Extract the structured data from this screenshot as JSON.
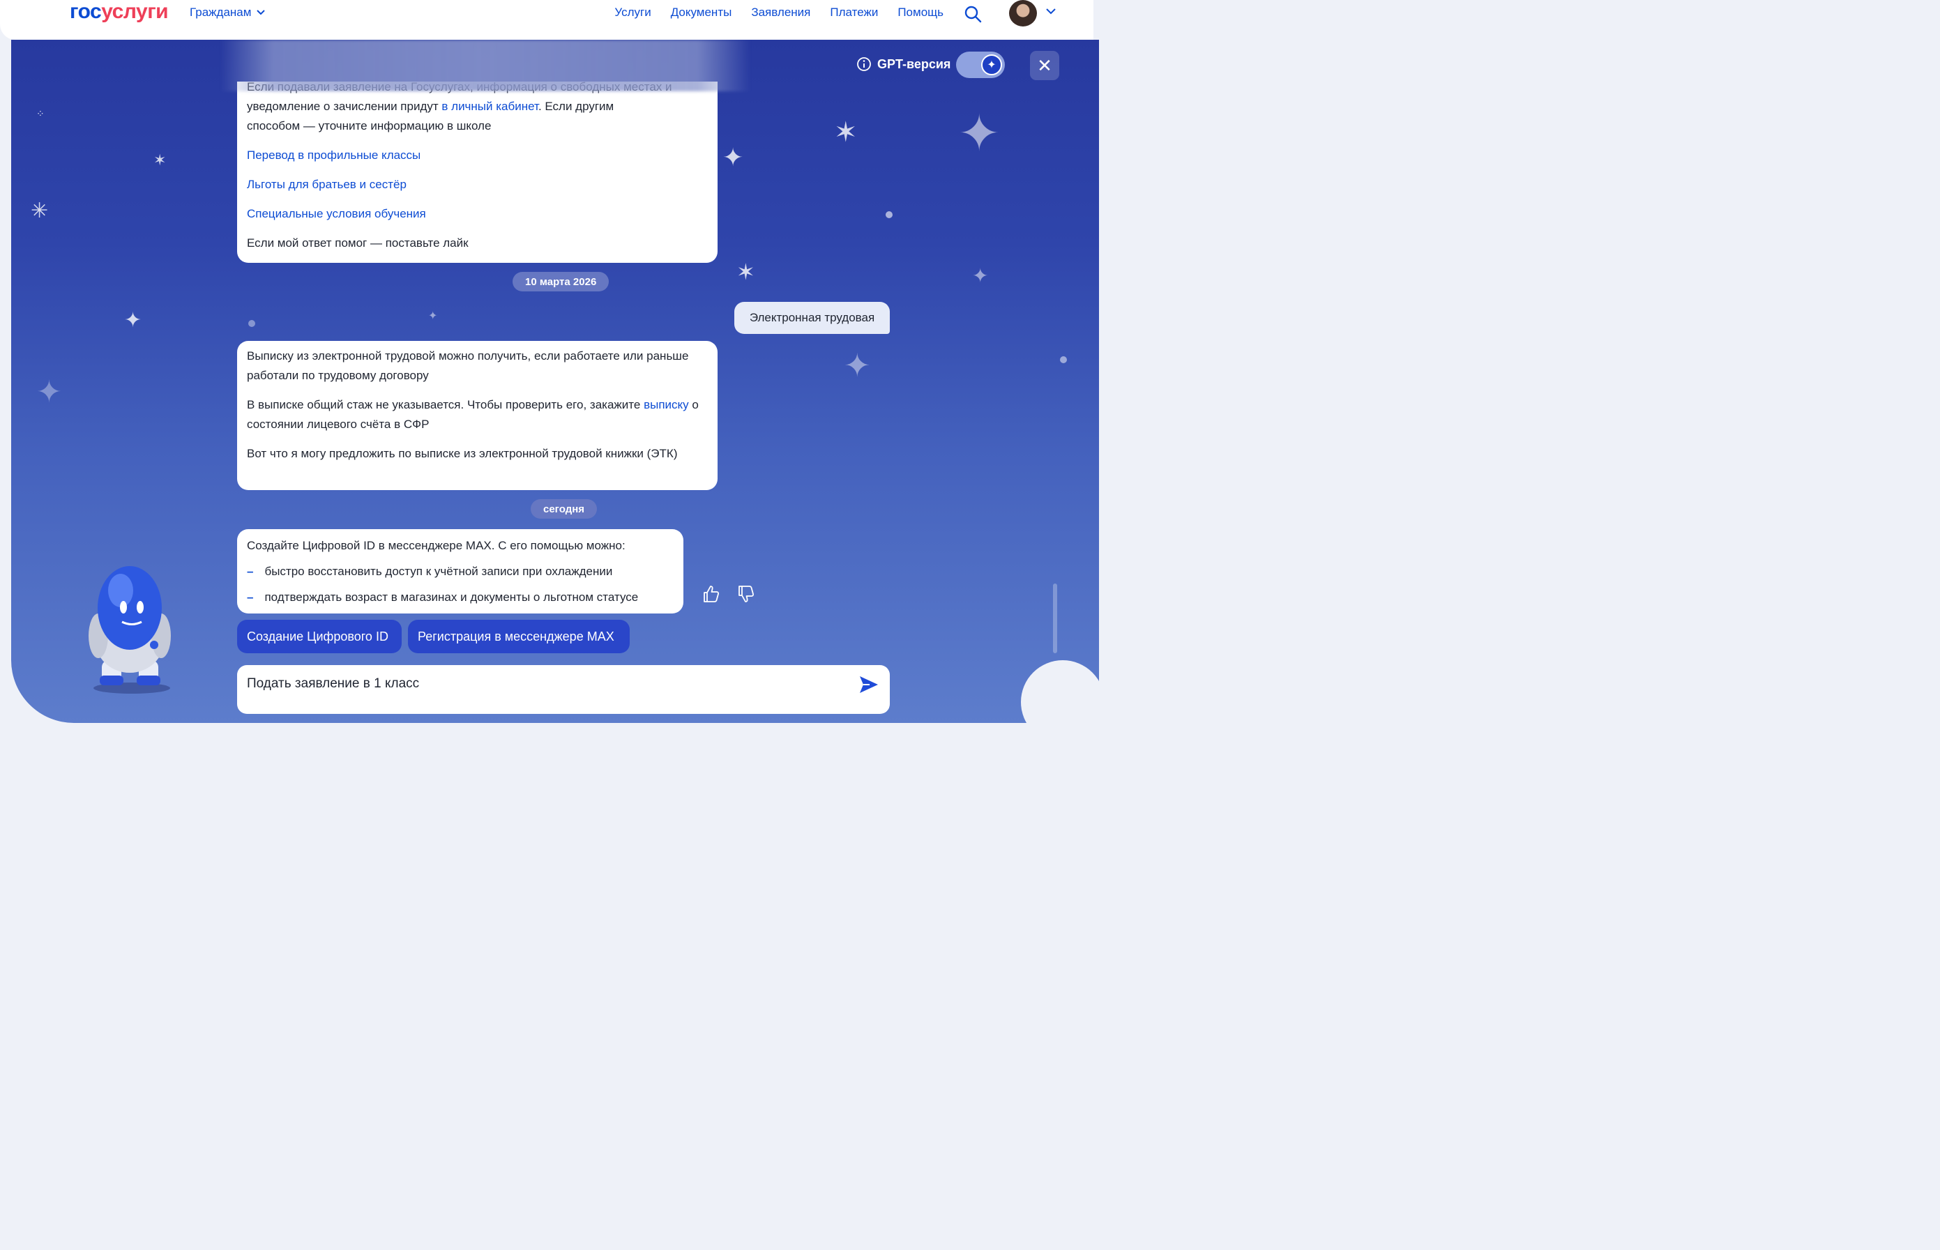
{
  "header": {
    "logo_part1": "гос",
    "logo_part2": "услуги",
    "citizens_label": "Гражданам",
    "nav": [
      "Услуги",
      "Документы",
      "Заявления",
      "Платежи",
      "Помощь"
    ]
  },
  "chat": {
    "gpt_label": "GPT-версия",
    "gpt_toggle_on": true,
    "first_message": {
      "clipped_line": "Если подавали заявление на Госуслугах, информация о свободных местах и",
      "clipped_link": "о свободных местах",
      "line2_before": "уведомление о зачислении придут ",
      "line2_link": "в личный кабинет",
      "line2_after": ". Если другим",
      "line3": "способом — уточните информацию в школе",
      "links": [
        "Перевод в профильные классы",
        "Льготы для братьев и сестёр",
        "Специальные условия обучения"
      ],
      "footer": "Если мой ответ помог — поставьте лайк"
    },
    "date1": "10 марта 2026",
    "user_message": "Электронная трудовая",
    "second_message": {
      "p1": "Выписку из электронной трудовой можно получить, если работаете или раньше работали по трудовому договору",
      "p2_before": "В выписке общий стаж не указывается. Чтобы проверить его, закажите ",
      "p2_link": "выписку",
      "p2_after": " о состоянии лицевого счёта в СФР",
      "p3": "Вот что я могу предложить по выписке из электронной трудовой книжки (ЭТК)"
    },
    "date2": "сегодня",
    "third_message": {
      "intro": "Создайте Цифровой ID в мессенджере MAX. С его помощью можно:",
      "items": [
        "быстро восстановить доступ к учётной записи при охлаждении",
        "подтверждать возраст в магазинах и документы о льготном статусе"
      ]
    },
    "chips": [
      "Создание Цифрового ID",
      "Регистрация в мессенджере MAX"
    ],
    "input_value": "Подать заявление в 1 класс"
  },
  "icons": {
    "search": "search-icon",
    "send": "send-icon",
    "like": "thumbs-up-icon",
    "dislike": "thumbs-down-icon",
    "info": "info-icon",
    "close": "close-icon"
  },
  "colors": {
    "brand_blue": "#0d4cd3",
    "brand_red": "#ee3f58",
    "panel_top": "#27399f",
    "panel_bottom": "#5d7dcc"
  }
}
